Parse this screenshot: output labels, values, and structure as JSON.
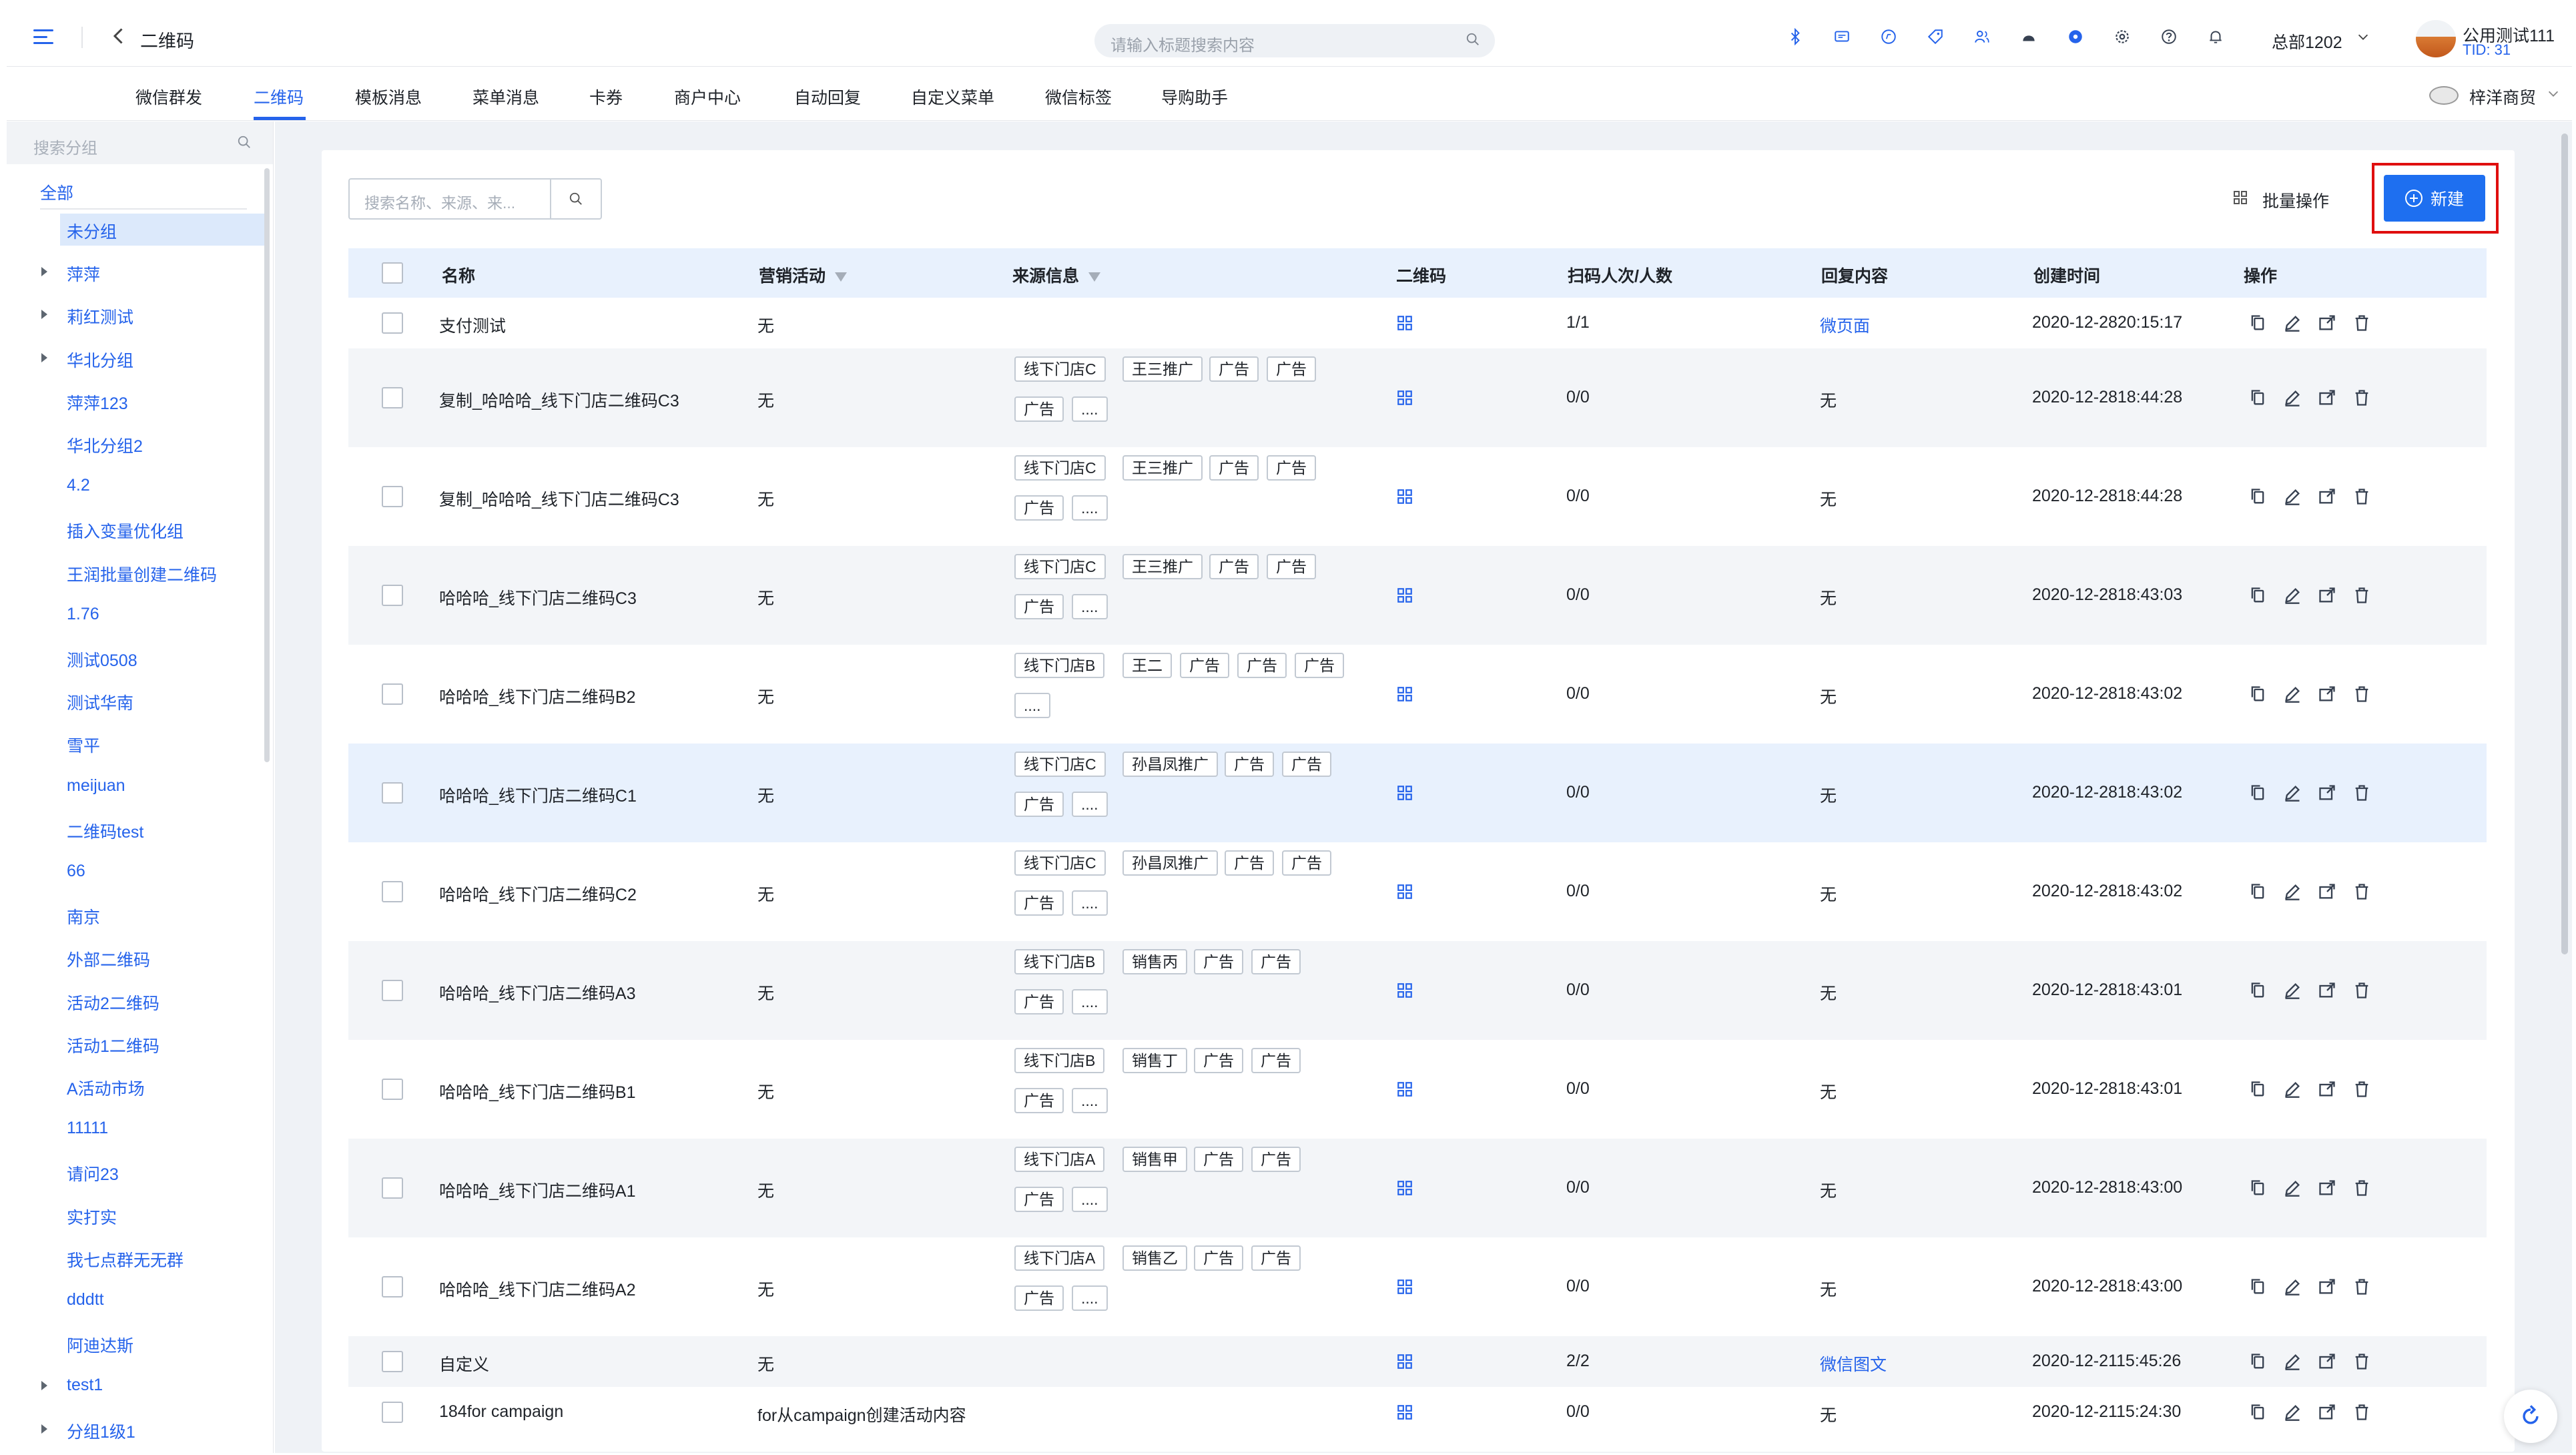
{
  "header": {
    "title": "二维码",
    "search_placeholder": "请输入标题搜索内容",
    "org": "总部1202",
    "user_name": "公用测试111",
    "tid": "TID: 31",
    "icons": [
      "bluetooth-icon",
      "message-icon",
      "compass-icon",
      "tag-icon",
      "users-icon",
      "chat-icon",
      "dot-icon",
      "settings-icon",
      "help-icon",
      "bell-icon"
    ]
  },
  "nav": {
    "tabs": [
      "微信群发",
      "二维码",
      "模板消息",
      "菜单消息",
      "卡券",
      "商户中心",
      "自动回复",
      "自定义菜单",
      "微信标签",
      "导购助手"
    ],
    "active": "二维码",
    "brand": "梓洋商贸"
  },
  "sidebar": {
    "search_placeholder": "搜索分组",
    "all_label": "全部",
    "items": [
      {
        "label": "未分组",
        "arrow": false,
        "selected": true
      },
      {
        "label": "萍萍",
        "arrow": true
      },
      {
        "label": "莉红测试",
        "arrow": true
      },
      {
        "label": "华北分组",
        "arrow": true
      },
      {
        "label": "萍萍123",
        "arrow": false
      },
      {
        "label": "华北分组2",
        "arrow": false
      },
      {
        "label": "4.2",
        "arrow": false
      },
      {
        "label": "插入变量优化组",
        "arrow": false
      },
      {
        "label": "王润批量创建二维码",
        "arrow": false
      },
      {
        "label": "1.76",
        "arrow": false
      },
      {
        "label": "测试0508",
        "arrow": false
      },
      {
        "label": "测试华南",
        "arrow": false
      },
      {
        "label": "雪平",
        "arrow": false
      },
      {
        "label": "meijuan",
        "arrow": false
      },
      {
        "label": "二维码test",
        "arrow": false
      },
      {
        "label": "66",
        "arrow": false
      },
      {
        "label": "南京",
        "arrow": false
      },
      {
        "label": "外部二维码",
        "arrow": false
      },
      {
        "label": "活动2二维码",
        "arrow": false
      },
      {
        "label": "活动1二维码",
        "arrow": false
      },
      {
        "label": "A活动市场",
        "arrow": false
      },
      {
        "label": "11111",
        "arrow": false
      },
      {
        "label": "请问23",
        "arrow": false
      },
      {
        "label": "实打实",
        "arrow": false
      },
      {
        "label": "我七点群无无群",
        "arrow": false
      },
      {
        "label": "dddtt",
        "arrow": false
      },
      {
        "label": "阿迪达斯",
        "arrow": false
      },
      {
        "label": "test1",
        "arrow": true
      },
      {
        "label": "分组1级1",
        "arrow": true
      }
    ]
  },
  "toolbar": {
    "search_placeholder": "搜索名称、来源、来...",
    "batch_label": "批量操作",
    "new_label": "新建"
  },
  "table": {
    "columns": [
      "名称",
      "营销活动",
      "来源信息",
      "二维码",
      "扫码人次/人数",
      "回复内容",
      "创建时间",
      "操作"
    ],
    "rows": [
      {
        "name": "支付测试",
        "activity": "无",
        "tags1": [],
        "tags2": [],
        "scan": "1/1",
        "reply": "微页面",
        "reply_link": true,
        "created": "2020-12-2820:15:17",
        "style": "plain"
      },
      {
        "name": "复制_哈哈哈_线下门店二维码C3",
        "activity": "无",
        "tags1": [
          "线下门店C",
          "王三推广",
          "广告",
          "广告"
        ],
        "tags2": [
          "广告",
          "...."
        ],
        "scan": "0/0",
        "reply": "无",
        "reply_link": false,
        "created": "2020-12-2818:44:28",
        "style": "alt"
      },
      {
        "name": "复制_哈哈哈_线下门店二维码C3",
        "activity": "无",
        "tags1": [
          "线下门店C",
          "王三推广",
          "广告",
          "广告"
        ],
        "tags2": [
          "广告",
          "...."
        ],
        "scan": "0/0",
        "reply": "无",
        "reply_link": false,
        "created": "2020-12-2818:44:28",
        "style": "plain"
      },
      {
        "name": "哈哈哈_线下门店二维码C3",
        "activity": "无",
        "tags1": [
          "线下门店C",
          "王三推广",
          "广告",
          "广告"
        ],
        "tags2": [
          "广告",
          "...."
        ],
        "scan": "0/0",
        "reply": "无",
        "reply_link": false,
        "created": "2020-12-2818:43:03",
        "style": "alt"
      },
      {
        "name": "哈哈哈_线下门店二维码B2",
        "activity": "无",
        "tags1": [
          "线下门店B",
          "王二",
          "广告",
          "广告",
          "广告"
        ],
        "tags2": [
          "...."
        ],
        "scan": "0/0",
        "reply": "无",
        "reply_link": false,
        "created": "2020-12-2818:43:02",
        "style": "plain"
      },
      {
        "name": "哈哈哈_线下门店二维码C1",
        "activity": "无",
        "tags1": [
          "线下门店C",
          "孙昌凤推广",
          "广告",
          "广告"
        ],
        "tags2": [
          "广告",
          "...."
        ],
        "scan": "0/0",
        "reply": "无",
        "reply_link": false,
        "created": "2020-12-2818:43:02",
        "style": "hl"
      },
      {
        "name": "哈哈哈_线下门店二维码C2",
        "activity": "无",
        "tags1": [
          "线下门店C",
          "孙昌凤推广",
          "广告",
          "广告"
        ],
        "tags2": [
          "广告",
          "...."
        ],
        "scan": "0/0",
        "reply": "无",
        "reply_link": false,
        "created": "2020-12-2818:43:02",
        "style": "plain"
      },
      {
        "name": "哈哈哈_线下门店二维码A3",
        "activity": "无",
        "tags1": [
          "线下门店B",
          "销售丙",
          "广告",
          "广告"
        ],
        "tags2": [
          "广告",
          "...."
        ],
        "scan": "0/0",
        "reply": "无",
        "reply_link": false,
        "created": "2020-12-2818:43:01",
        "style": "alt"
      },
      {
        "name": "哈哈哈_线下门店二维码B1",
        "activity": "无",
        "tags1": [
          "线下门店B",
          "销售丁",
          "广告",
          "广告"
        ],
        "tags2": [
          "广告",
          "...."
        ],
        "scan": "0/0",
        "reply": "无",
        "reply_link": false,
        "created": "2020-12-2818:43:01",
        "style": "plain"
      },
      {
        "name": "哈哈哈_线下门店二维码A1",
        "activity": "无",
        "tags1": [
          "线下门店A",
          "销售甲",
          "广告",
          "广告"
        ],
        "tags2": [
          "广告",
          "...."
        ],
        "scan": "0/0",
        "reply": "无",
        "reply_link": false,
        "created": "2020-12-2818:43:00",
        "style": "alt"
      },
      {
        "name": "哈哈哈_线下门店二维码A2",
        "activity": "无",
        "tags1": [
          "线下门店A",
          "销售乙",
          "广告",
          "广告"
        ],
        "tags2": [
          "广告",
          "...."
        ],
        "scan": "0/0",
        "reply": "无",
        "reply_link": false,
        "created": "2020-12-2818:43:00",
        "style": "plain"
      },
      {
        "name": "自定义",
        "activity": "无",
        "tags1": [],
        "tags2": [],
        "scan": "2/2",
        "reply": "微信图文",
        "reply_link": true,
        "created": "2020-12-2115:45:26",
        "style": "alt"
      },
      {
        "name": "184for campaign",
        "activity": "for从campaign创建活动内容",
        "tags1": [],
        "tags2": [],
        "scan": "0/0",
        "reply": "无",
        "reply_link": false,
        "created": "2020-12-2115:24:30",
        "style": "plain"
      }
    ],
    "action_icons": [
      "copy-icon",
      "edit-icon",
      "share-icon",
      "delete-icon"
    ]
  },
  "colors": {
    "accent": "#2563eb",
    "primary_button": "#1e6ff0",
    "highlight_box": "#e00f0f"
  }
}
